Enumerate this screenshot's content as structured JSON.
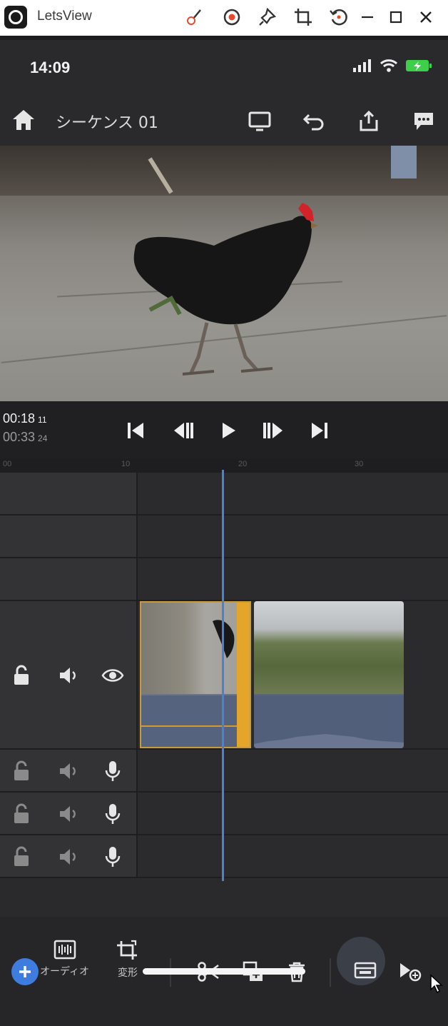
{
  "window": {
    "title": "LetsView",
    "toolbar_icons": [
      "brush-icon",
      "record-icon",
      "pin-icon",
      "crop-icon",
      "rotate-icon"
    ],
    "controls": [
      "minimize-icon",
      "maximize-icon",
      "close-icon"
    ]
  },
  "status_bar": {
    "time": "14:09",
    "icons": [
      "signal-icon",
      "wifi-icon",
      "battery-charging-icon"
    ],
    "battery_color": "#3ecf4a"
  },
  "app_bar": {
    "sequence_title": "シーケンス 01",
    "actions": [
      "preview-icon",
      "undo-icon",
      "share-icon",
      "feedback-icon"
    ]
  },
  "transport": {
    "current_time": "00:18",
    "current_frame": "11",
    "total_time": "00:33",
    "total_frame": "24",
    "controls": [
      "skip-start-icon",
      "step-back-icon",
      "play-icon",
      "step-forward-icon",
      "skip-end-icon"
    ]
  },
  "ruler": {
    "ticks": [
      "00",
      "10",
      "20",
      "30"
    ]
  },
  "tracks": {
    "video_track": {
      "icons": [
        "unlock-icon",
        "volume-icon",
        "eye-icon"
      ]
    },
    "audio_tracks": [
      {
        "icons": [
          "unlock-icon",
          "volume-icon",
          "mic-icon"
        ]
      },
      {
        "icons": [
          "unlock-icon",
          "volume-icon",
          "mic-icon"
        ]
      },
      {
        "icons": [
          "unlock-icon",
          "volume-icon",
          "mic-icon"
        ]
      }
    ],
    "selected_clip_color": "#e3a62a",
    "playhead_color": "#4d7fd6"
  },
  "bottom_toolbar": {
    "audio_label": "オーディオ",
    "transform_label": "変形",
    "tools": [
      "cut-icon",
      "duplicate-icon",
      "delete-icon",
      "replace-icon",
      "insert-icon"
    ],
    "accent": "#3f7ce0"
  }
}
